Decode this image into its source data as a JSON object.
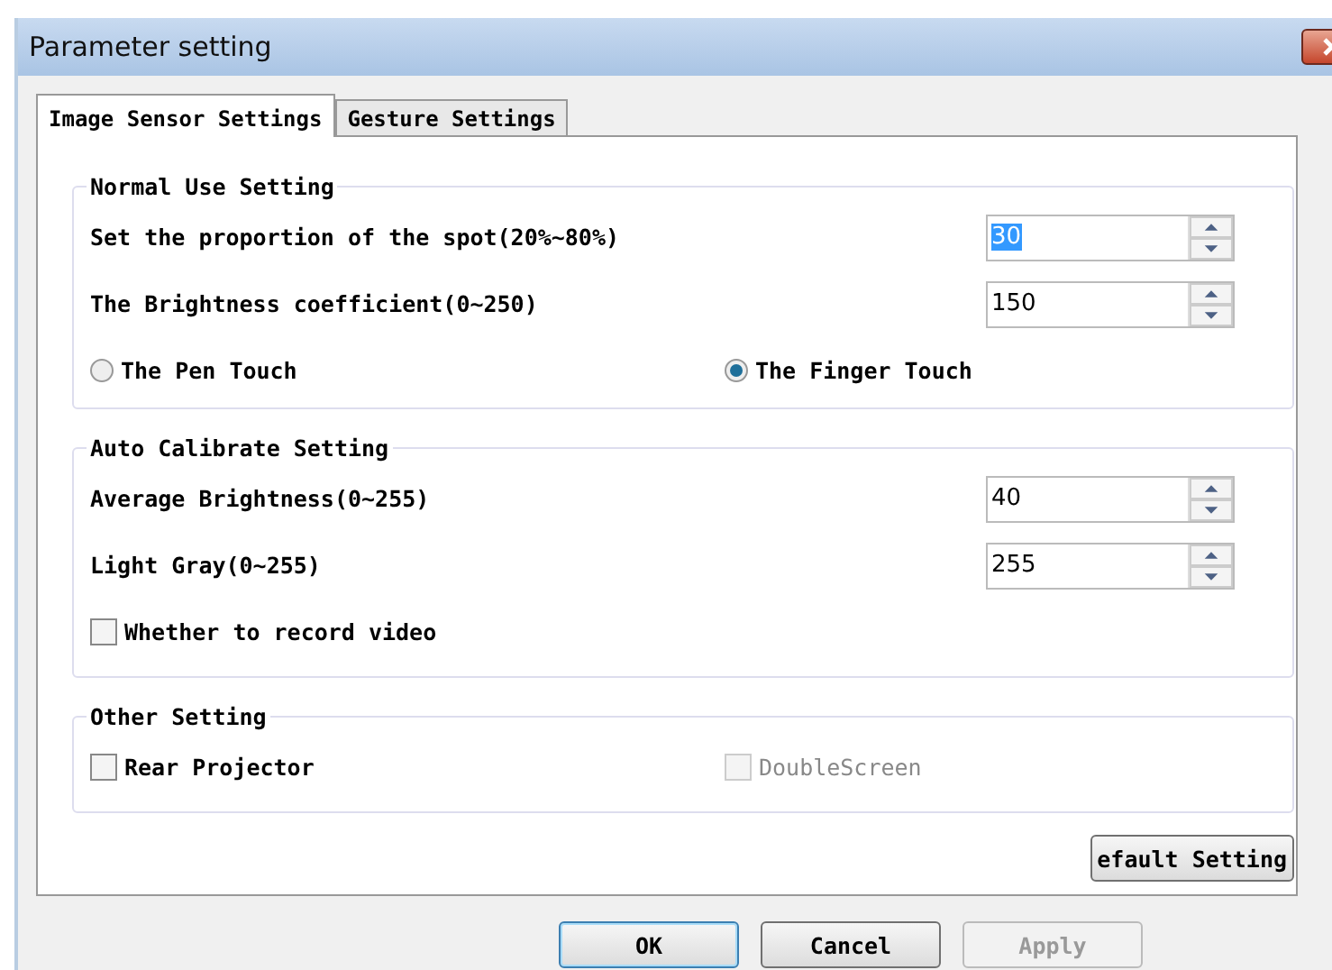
{
  "window": {
    "title": "Parameter setting"
  },
  "tabs": [
    {
      "label": "Image Sensor Settings",
      "selected": true
    },
    {
      "label": "Gesture Settings",
      "selected": false
    }
  ],
  "groups": [
    {
      "title": "Normal Use Setting",
      "rows": [
        {
          "kind": "spin",
          "label": "Set the proportion of the spot(20%~80%)",
          "value": "30",
          "text_selected": true
        },
        {
          "kind": "spin",
          "label": "The Brightness coefficient(0~250)",
          "value": "150",
          "text_selected": false
        },
        {
          "kind": "radios",
          "options": [
            {
              "label": "The Pen Touch",
              "selected": false
            },
            {
              "label": "The Finger Touch",
              "selected": true
            }
          ]
        }
      ]
    },
    {
      "title": "Auto Calibrate Setting",
      "rows": [
        {
          "kind": "spin",
          "label": "Average Brightness(0~255)",
          "value": "40",
          "text_selected": false
        },
        {
          "kind": "spin",
          "label": "Light Gray(0~255)",
          "value": "255",
          "text_selected": false
        },
        {
          "kind": "checks",
          "options": [
            {
              "label": "Whether to record video",
              "checked": false,
              "disabled": false
            }
          ]
        }
      ]
    },
    {
      "title": "Other Setting",
      "rows": [
        {
          "kind": "checks",
          "options": [
            {
              "label": "Rear Projector",
              "checked": false,
              "disabled": false
            },
            {
              "label": "DoubleScreen",
              "checked": false,
              "disabled": true
            }
          ]
        }
      ]
    }
  ],
  "default_button": "efault Setting",
  "buttons": [
    {
      "label": "OK",
      "default": true,
      "disabled": false
    },
    {
      "label": "Cancel",
      "default": false,
      "disabled": false
    },
    {
      "label": "Apply",
      "default": false,
      "disabled": true
    }
  ]
}
